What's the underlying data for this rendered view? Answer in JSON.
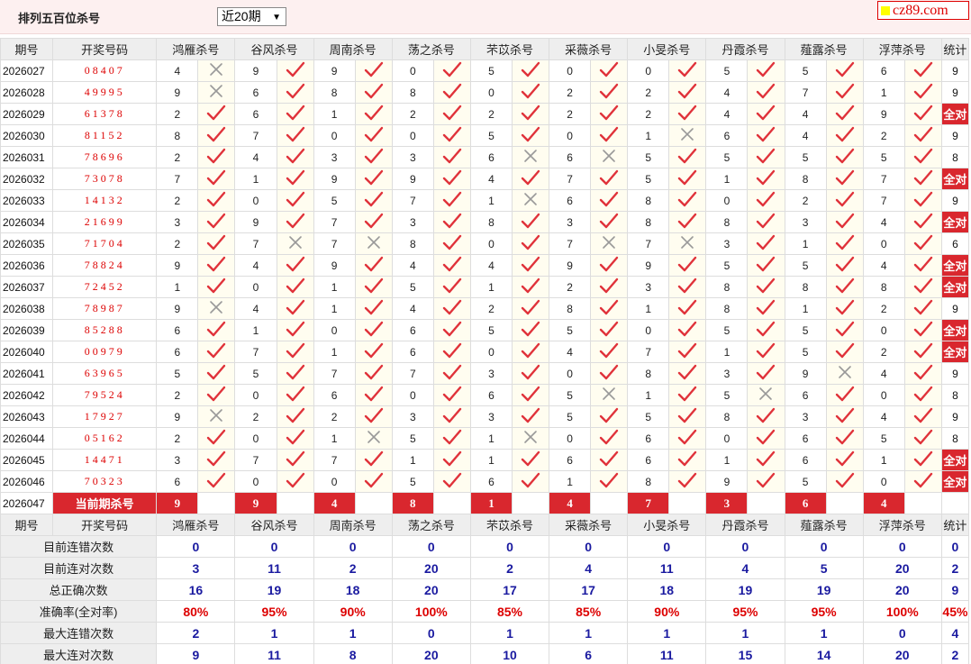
{
  "title": "排列五百位杀号",
  "period_select": "近20期",
  "logo": "cz89.com",
  "headers": [
    "期号",
    "开奖号码",
    "鸿雁杀号",
    "谷风杀号",
    "周南杀号",
    "荡之杀号",
    "芣苡杀号",
    "采薇杀号",
    "小旻杀号",
    "丹霞杀号",
    "薤露杀号",
    "浮萍杀号",
    "统计"
  ],
  "rows": [
    {
      "issue": "2026027",
      "num": "08407",
      "kills": [
        "4",
        "9",
        "9",
        "0",
        "5",
        "0",
        "0",
        "5",
        "5",
        "6"
      ],
      "marks": "xvvvvvvvvv",
      "total": "9"
    },
    {
      "issue": "2026028",
      "num": "49995",
      "kills": [
        "9",
        "6",
        "8",
        "8",
        "0",
        "2",
        "2",
        "4",
        "7",
        "1"
      ],
      "marks": "xvvvvvvvvv",
      "total": "9"
    },
    {
      "issue": "2026029",
      "num": "61378",
      "kills": [
        "2",
        "6",
        "1",
        "2",
        "2",
        "2",
        "2",
        "4",
        "4",
        "9"
      ],
      "marks": "vvvvvvvvvv",
      "total": "全对"
    },
    {
      "issue": "2026030",
      "num": "81152",
      "kills": [
        "8",
        "7",
        "0",
        "0",
        "5",
        "0",
        "1",
        "6",
        "4",
        "2"
      ],
      "marks": "vvvvvvxvvv",
      "total": "9"
    },
    {
      "issue": "2026031",
      "num": "78696",
      "kills": [
        "2",
        "4",
        "3",
        "3",
        "6",
        "6",
        "5",
        "5",
        "5",
        "5"
      ],
      "marks": "vvvvxxvvvv",
      "total": "8"
    },
    {
      "issue": "2026032",
      "num": "73078",
      "kills": [
        "7",
        "1",
        "9",
        "9",
        "4",
        "7",
        "5",
        "1",
        "8",
        "7"
      ],
      "marks": "vvvvvvvvvv",
      "total": "全对"
    },
    {
      "issue": "2026033",
      "num": "14132",
      "kills": [
        "2",
        "0",
        "5",
        "7",
        "1",
        "6",
        "8",
        "0",
        "2",
        "7"
      ],
      "marks": "vvvvxvvvvv",
      "total": "9"
    },
    {
      "issue": "2026034",
      "num": "21699",
      "kills": [
        "3",
        "9",
        "7",
        "3",
        "8",
        "3",
        "8",
        "8",
        "3",
        "4"
      ],
      "marks": "vvvvvvvvvv",
      "total": "全对"
    },
    {
      "issue": "2026035",
      "num": "71704",
      "kills": [
        "2",
        "7",
        "7",
        "8",
        "0",
        "7",
        "7",
        "3",
        "1",
        "0"
      ],
      "marks": "vxxvvxxvvv",
      "total": "6"
    },
    {
      "issue": "2026036",
      "num": "78824",
      "kills": [
        "9",
        "4",
        "9",
        "4",
        "4",
        "9",
        "9",
        "5",
        "5",
        "4"
      ],
      "marks": "vvvvvvvvvv",
      "total": "全对"
    },
    {
      "issue": "2026037",
      "num": "72452",
      "kills": [
        "1",
        "0",
        "1",
        "5",
        "1",
        "2",
        "3",
        "8",
        "8",
        "8"
      ],
      "marks": "vvvvvvvvvv",
      "total": "全对"
    },
    {
      "issue": "2026038",
      "num": "78987",
      "kills": [
        "9",
        "4",
        "1",
        "4",
        "2",
        "8",
        "1",
        "8",
        "1",
        "2"
      ],
      "marks": "xvvvvvvvvv",
      "total": "9"
    },
    {
      "issue": "2026039",
      "num": "85288",
      "kills": [
        "6",
        "1",
        "0",
        "6",
        "5",
        "5",
        "0",
        "5",
        "5",
        "0"
      ],
      "marks": "vvvvvvvvvv",
      "total": "全对"
    },
    {
      "issue": "2026040",
      "num": "00979",
      "kills": [
        "6",
        "7",
        "1",
        "6",
        "0",
        "4",
        "7",
        "1",
        "5",
        "2"
      ],
      "marks": "vvvvvvvvvv",
      "total": "全对"
    },
    {
      "issue": "2026041",
      "num": "63965",
      "kills": [
        "5",
        "5",
        "7",
        "7",
        "3",
        "0",
        "8",
        "3",
        "9",
        "4"
      ],
      "marks": "vvvvvvvvxv",
      "total": "9"
    },
    {
      "issue": "2026042",
      "num": "79524",
      "kills": [
        "2",
        "0",
        "6",
        "0",
        "6",
        "5",
        "1",
        "5",
        "6",
        "0"
      ],
      "marks": "vvvvvxvxvv",
      "total": "8"
    },
    {
      "issue": "2026043",
      "num": "17927",
      "kills": [
        "9",
        "2",
        "2",
        "3",
        "3",
        "5",
        "5",
        "8",
        "3",
        "4"
      ],
      "marks": "xvvvvvvvvv",
      "total": "9"
    },
    {
      "issue": "2026044",
      "num": "05162",
      "kills": [
        "2",
        "0",
        "1",
        "5",
        "1",
        "0",
        "6",
        "0",
        "6",
        "5"
      ],
      "marks": "vvxvxvvvvv",
      "total": "8"
    },
    {
      "issue": "2026045",
      "num": "14471",
      "kills": [
        "3",
        "7",
        "7",
        "1",
        "1",
        "6",
        "6",
        "1",
        "6",
        "1"
      ],
      "marks": "vvvvvvvvvv",
      "total": "全对"
    },
    {
      "issue": "2026046",
      "num": "70323",
      "kills": [
        "6",
        "0",
        "0",
        "5",
        "6",
        "1",
        "8",
        "9",
        "5",
        "0"
      ],
      "marks": "vvvvvvvvvv",
      "total": "全对"
    }
  ],
  "current": {
    "issue": "2026047",
    "label": "当前期杀号",
    "kills": [
      "9",
      "9",
      "4",
      "8",
      "1",
      "4",
      "7",
      "3",
      "6",
      "4"
    ]
  },
  "stats": [
    {
      "label": "目前连错次数",
      "values": [
        "0",
        "0",
        "0",
        "0",
        "0",
        "0",
        "0",
        "0",
        "0",
        "0",
        "0"
      ],
      "style": "blue"
    },
    {
      "label": "目前连对次数",
      "values": [
        "3",
        "11",
        "2",
        "20",
        "2",
        "4",
        "11",
        "4",
        "5",
        "20",
        "2"
      ],
      "style": "blue"
    },
    {
      "label": "总正确次数",
      "values": [
        "16",
        "19",
        "18",
        "20",
        "17",
        "17",
        "18",
        "19",
        "19",
        "20",
        "9"
      ],
      "style": "blue"
    },
    {
      "label": "准确率(全对率)",
      "values": [
        "80%",
        "95%",
        "90%",
        "100%",
        "85%",
        "85%",
        "90%",
        "95%",
        "95%",
        "100%",
        "45%"
      ],
      "style": "red"
    },
    {
      "label": "最大连错次数",
      "values": [
        "2",
        "1",
        "1",
        "0",
        "1",
        "1",
        "1",
        "1",
        "1",
        "0",
        "4"
      ],
      "style": "blue"
    },
    {
      "label": "最大连对次数",
      "values": [
        "9",
        "11",
        "8",
        "20",
        "10",
        "6",
        "11",
        "15",
        "14",
        "20",
        "2"
      ],
      "style": "blue"
    }
  ],
  "colors": {
    "accent": "#d9272e",
    "check": "#e0323a",
    "cross": "#999999",
    "header_bg": "#eeeeee",
    "mark_bg": "#fffdf0",
    "topbar_bg": "#fdf0f0"
  },
  "icons": {
    "correct": "check-icon",
    "wrong": "cross-icon"
  }
}
